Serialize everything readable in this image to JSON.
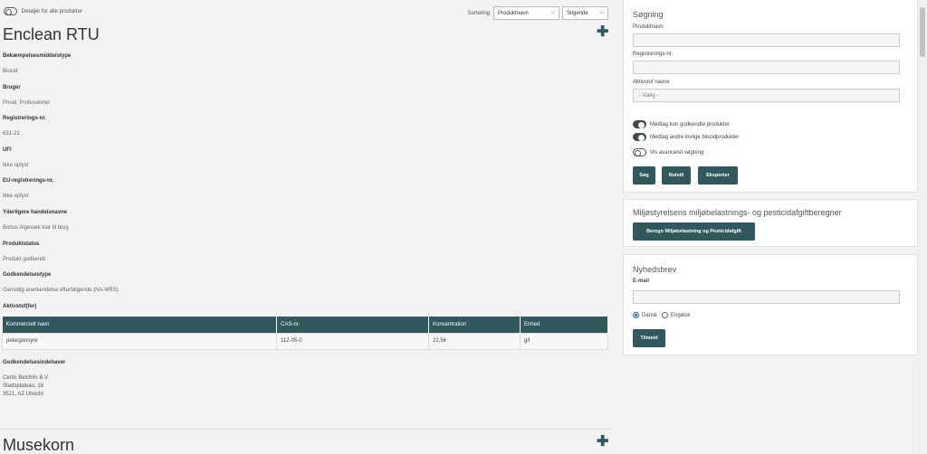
{
  "toolbar": {
    "details_toggle_label": "Detaljer for alle produkter",
    "sort_label": "Sortering",
    "sort_field": "Produktnavn",
    "sort_order": "Stigende"
  },
  "product1": {
    "title": "Enclean RTU",
    "fields": [
      {
        "label": "Bekæmpelsesmiddelstype",
        "value": "Biocid"
      },
      {
        "label": "Bruger",
        "value": "Privat, Professionel"
      },
      {
        "label": "Registrerings-nr.",
        "value": "631-21"
      },
      {
        "label": "UFI",
        "value": "Ikke oplyst"
      },
      {
        "label": "EU-registrerings-nr.",
        "value": "Ikke oplyst"
      },
      {
        "label": "Yderligere handelsnavne",
        "value": "Bonus Algevæk klar til brug"
      },
      {
        "label": "Produktstatus",
        "value": "Produkt godkendt"
      },
      {
        "label": "Godkendelsestype",
        "value": "Gensidig anerkendelse efterfølgende (NA-MRS)"
      }
    ],
    "active_label": "Aktivstof(fer)",
    "table": {
      "headers": [
        "Kommercielt navn",
        "CAS-nr.",
        "Koncentration",
        "Enhed"
      ],
      "rows": [
        [
          "pelargonsyre",
          "112-05-0",
          "22,56",
          "g/l"
        ]
      ]
    },
    "holder_label": "Godkendelsesindehaver",
    "holder": {
      "name": "Certis Belchim B.V.",
      "street": "Stadsplateau, 16",
      "city": "3521, AZ Utrecht"
    }
  },
  "product2": {
    "title": "Musekorn"
  },
  "search": {
    "title": "Søgning",
    "product_name_label": "Produktnavn",
    "product_name_value": "",
    "reg_label": "Registrerings-nr.",
    "reg_value": "",
    "active_label": "Aktivstof navne",
    "active_placeholder": "- Vælg -",
    "toggle_approved": "Medtag kun godkendte produkter",
    "toggle_other": "Medtag andre lovlige biocidprodukter",
    "toggle_advanced": "Vis avanceret søgning",
    "btn_search": "Søg",
    "btn_reset": "Nulstil",
    "btn_export": "Eksporter"
  },
  "calc": {
    "title": "Miljøstyrelsens miljøbelastnings- og pesticidafgiftberegner",
    "button": "Beregn Miljøbelastning og Pesticidafgift"
  },
  "newsletter": {
    "title": "Nyhedsbrev",
    "email_label": "E-mail",
    "email_value": "",
    "lang_da": "Dansk",
    "lang_en": "Engelsk",
    "button": "Tilmeld"
  },
  "colors": {
    "accent": "#30585d",
    "background": "#f2f2f2"
  }
}
